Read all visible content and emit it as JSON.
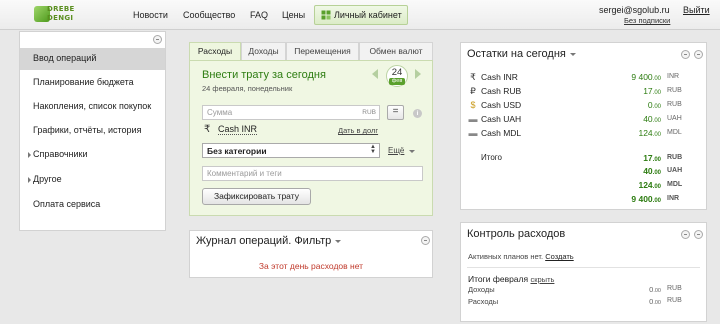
{
  "header": {
    "logo_lines": [
      "DREBE",
      "DENGI"
    ],
    "nav": [
      "Новости",
      "Сообщество",
      "FAQ",
      "Цены"
    ],
    "cabinet_label": "Личный кабинет",
    "user_email": "sergei@sgolub.ru",
    "subscription": "Без подписки",
    "logout": "Выйти"
  },
  "sidebar": {
    "items": [
      {
        "label": "Ввод операций",
        "active": true
      },
      {
        "label": "Планирование бюджета"
      },
      {
        "label": "Накопления, список покупок"
      },
      {
        "label": "Графики, отчёты, история"
      },
      {
        "label": "Справочники",
        "expandable": true
      },
      {
        "label": "Другое",
        "expandable": true
      },
      {
        "label": "Оплата сервиса"
      }
    ]
  },
  "tabs": [
    "Расходы",
    "Доходы",
    "Перемещения",
    "Обмен валют"
  ],
  "expense_form": {
    "title": "Внести трату за сегодня",
    "date": "24 февраля, понедельник",
    "day": "24",
    "month": "фев",
    "amount_placeholder": "Сумма",
    "amount_unit": "RUB",
    "eq": "=",
    "info": "i",
    "account_symbol": "₹",
    "account": "Cash INR",
    "debt_link": "Дать в долг",
    "category": "Без категории",
    "more": "Ещё",
    "comment_placeholder": "Комментарий и теги",
    "submit": "Зафиксировать трату"
  },
  "journal": {
    "title": "Журнал операций. Фильтр",
    "empty": "За этот день расходов нет"
  },
  "balances": {
    "title": "Остатки на сегодня",
    "accounts": [
      {
        "icon": "₹",
        "name": "Cash INR",
        "amount": "9 400",
        "cents": ".00",
        "currency": "INR"
      },
      {
        "icon": "₽",
        "name": "Cash RUB",
        "amount": "17",
        "cents": ".00",
        "currency": "RUB"
      },
      {
        "icon": "$",
        "name": "Cash USD",
        "amount": "0",
        "cents": ".00",
        "currency": "RUB"
      },
      {
        "icon": "▬",
        "name": "Cash UAH",
        "amount": "40",
        "cents": ".00",
        "currency": "UAH"
      },
      {
        "icon": "▬",
        "name": "Cash MDL",
        "amount": "124",
        "cents": ".00",
        "currency": "MDL"
      }
    ],
    "total_label": "Итого",
    "totals": [
      {
        "amount": "17",
        "cents": ".00",
        "currency": "RUB"
      },
      {
        "amount": "40",
        "cents": ".00",
        "currency": "UAH"
      },
      {
        "amount": "124",
        "cents": ".00",
        "currency": "MDL"
      },
      {
        "amount": "9 400",
        "cents": ".00",
        "currency": "INR"
      }
    ]
  },
  "control": {
    "title": "Контроль расходов",
    "no_plans": "Активных планов нет.",
    "create": "Создать",
    "month_totals": "Итоги февраля",
    "hide": "скрыть",
    "income_label": "Доходы",
    "income_amount": "0",
    "income_cents": ".00",
    "income_cur": "RUB",
    "expense_label": "Расходы",
    "expense_amount": "0",
    "expense_cents": ".00",
    "expense_cur": "RUB"
  },
  "colors": {
    "accent_green": "#2e7d12",
    "form_bg": "#f0f7e3",
    "error_red": "#c0392b"
  }
}
